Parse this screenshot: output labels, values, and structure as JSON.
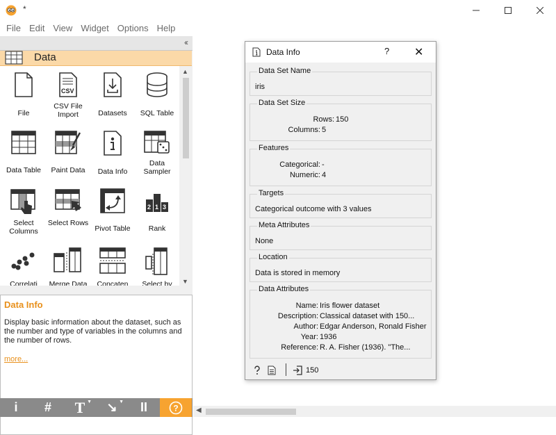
{
  "window": {
    "title": "*"
  },
  "menu": [
    "File",
    "Edit",
    "View",
    "Widget",
    "Options",
    "Help"
  ],
  "colors": {
    "accent": "#f7a330",
    "category_bg": "#fbd9a8",
    "help_title": "#e8901b",
    "toolbar_bg": "#8a8a8a"
  },
  "sidebar": {
    "category": "Data",
    "widgets": [
      {
        "label": "File",
        "icon": "file-icon"
      },
      {
        "label": "CSV File Import",
        "icon": "csv-icon"
      },
      {
        "label": "Datasets",
        "icon": "datasets-icon"
      },
      {
        "label": "SQL Table",
        "icon": "database-icon"
      },
      {
        "label": "Data Table",
        "icon": "table-icon"
      },
      {
        "label": "Paint Data",
        "icon": "paint-icon"
      },
      {
        "label": "Data Info",
        "icon": "info-icon"
      },
      {
        "label": "Data Sampler",
        "icon": "sampler-icon"
      },
      {
        "label": "Select Columns",
        "icon": "select-columns-icon"
      },
      {
        "label": "Select Rows",
        "icon": "select-rows-icon"
      },
      {
        "label": "Pivot Table",
        "icon": "pivot-icon"
      },
      {
        "label": "Rank",
        "icon": "rank-icon"
      },
      {
        "label": "Correlati",
        "icon": "correlations-icon"
      },
      {
        "label": "Merge Data",
        "icon": "merge-icon"
      },
      {
        "label": "Concaten",
        "icon": "concatenate-icon"
      },
      {
        "label": "Select by",
        "icon": "select-by-icon"
      }
    ]
  },
  "help": {
    "title": "Data Info",
    "description": "Display basic information about the dataset, such as the number and type of variables in the columns and the number of rows.",
    "more": "more..."
  },
  "toolbar": [
    "i",
    "#",
    "T",
    "↘",
    "II",
    "?"
  ],
  "dialog": {
    "title": "Data Info",
    "help": "?",
    "close": "✕",
    "name_group": {
      "title": "Data Set Name",
      "value": "iris"
    },
    "size_group": {
      "title": "Data Set Size",
      "rows_label": "Rows:",
      "rows_value": "150",
      "columns_label": "Columns:",
      "columns_value": "5"
    },
    "features_group": {
      "title": "Features",
      "categorical_label": "Categorical:",
      "categorical_value": "-",
      "numeric_label": "Numeric:",
      "numeric_value": "4"
    },
    "targets_group": {
      "title": "Targets",
      "value": "Categorical outcome with 3 values"
    },
    "meta_group": {
      "title": "Meta Attributes",
      "value": "None"
    },
    "location_group": {
      "title": "Location",
      "value": "Data is stored in memory"
    },
    "attributes_group": {
      "title": "Data Attributes",
      "rows": [
        {
          "key": "Name:",
          "value": "Iris flower dataset"
        },
        {
          "key": "Description:",
          "value": "Classical dataset with 150..."
        },
        {
          "key": "Author:",
          "value": "Edgar Anderson, Ronald Fisher"
        },
        {
          "key": "Year:",
          "value": "1936"
        },
        {
          "key": "Reference:",
          "value": "R. A. Fisher (1936). \"The..."
        }
      ]
    },
    "footer": {
      "rows": "150"
    }
  }
}
